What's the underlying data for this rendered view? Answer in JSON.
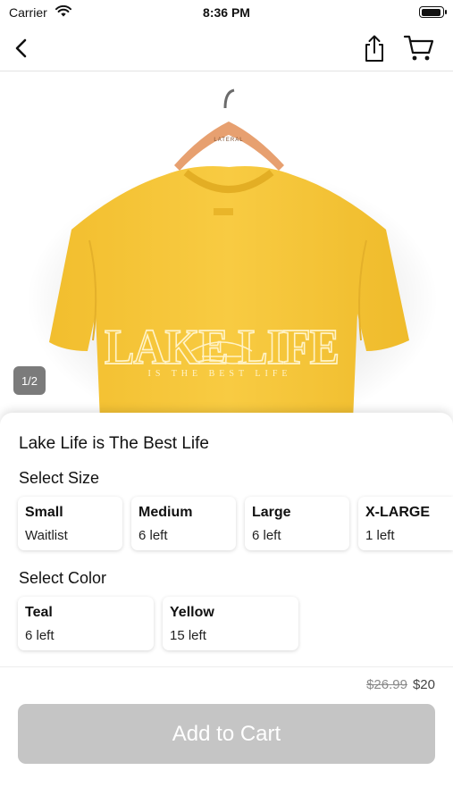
{
  "status_bar": {
    "carrier": "Carrier",
    "time": "8:36 PM"
  },
  "product": {
    "title": "Lake Life is The Best Life",
    "image_page": "1/2",
    "image_shirt_text": "LAKE LIFE",
    "image_shirt_subtext": "IS THE BEST LIFE",
    "image_hanger_text": "LATERAL"
  },
  "size_section": {
    "label": "Select Size",
    "options": [
      {
        "name": "Small",
        "stock": "Waitlist"
      },
      {
        "name": "Medium",
        "stock": "6 left"
      },
      {
        "name": "Large",
        "stock": "6 left"
      },
      {
        "name": "X-LARGE",
        "stock": "1 left"
      }
    ]
  },
  "color_section": {
    "label": "Select Color",
    "options": [
      {
        "name": "Teal",
        "stock": "6 left"
      },
      {
        "name": "Yellow",
        "stock": "15 left"
      }
    ]
  },
  "pricing": {
    "original": "$26.99",
    "sale": "$20"
  },
  "actions": {
    "add_to_cart": "Add to Cart"
  },
  "icons": [
    "back-icon",
    "share-icon",
    "cart-icon",
    "wifi-icon",
    "battery-icon"
  ],
  "colors": {
    "shirt": "#F7C83C",
    "button_disabled": "#C5C5C5",
    "hanger": "#E7A070"
  }
}
